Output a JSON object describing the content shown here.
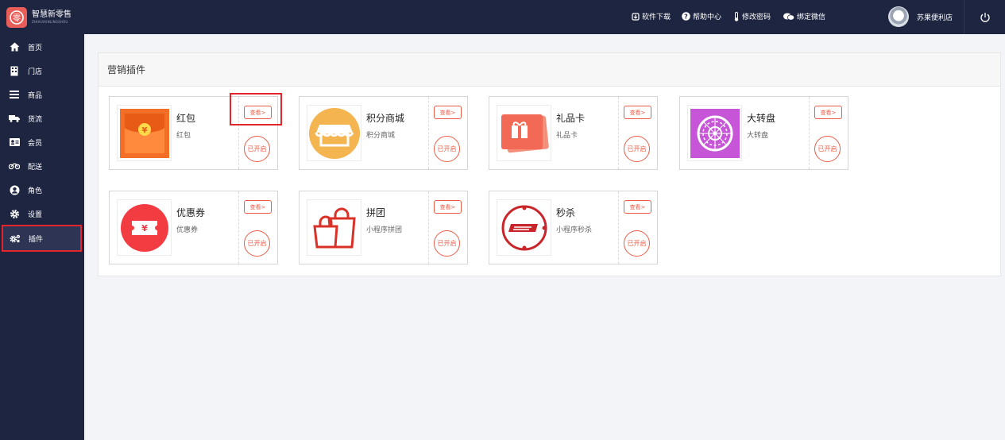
{
  "brand": {
    "name_cn": "智慧新零售",
    "name_en": "ZHIHUIXINLINGSHOU",
    "logo_char": "零"
  },
  "topnav": {
    "download": "软件下载",
    "help": "帮助中心",
    "change_password": "修改密码",
    "bind_wechat": "绑定微信"
  },
  "user": {
    "store_name": "苏果便利店"
  },
  "sidebar": {
    "items": [
      {
        "label": "首页",
        "icon": "home-icon"
      },
      {
        "label": "门店",
        "icon": "store-icon"
      },
      {
        "label": "商品",
        "icon": "list-icon"
      },
      {
        "label": "货流",
        "icon": "truck-icon"
      },
      {
        "label": "会员",
        "icon": "id-card-icon"
      },
      {
        "label": "配送",
        "icon": "motorbike-icon"
      },
      {
        "label": "角色",
        "icon": "user-circle-icon"
      },
      {
        "label": "设置",
        "icon": "gear-icon"
      },
      {
        "label": "插件",
        "icon": "gears-icon"
      }
    ]
  },
  "panel": {
    "title": "营销插件",
    "view_label": "查看>",
    "status_label": "已开启",
    "plugins": [
      {
        "name": "红包",
        "desc": "红包",
        "icon": "red-envelope-icon"
      },
      {
        "name": "积分商城",
        "desc": "积分商城",
        "icon": "store-awning-icon"
      },
      {
        "name": "礼品卡",
        "desc": "礼品卡",
        "icon": "gift-card-icon"
      },
      {
        "name": "大转盘",
        "desc": "大转盘",
        "icon": "lucky-wheel-icon"
      },
      {
        "name": "优惠券",
        "desc": "优惠券",
        "icon": "coupon-icon"
      },
      {
        "name": "拼团",
        "desc": "小程序拼团",
        "icon": "shopping-bag-icon"
      },
      {
        "name": "秒杀",
        "desc": "小程序秒杀",
        "icon": "flash-sale-icon"
      }
    ]
  },
  "colors": {
    "sidebar_bg": "#1e2541",
    "accent": "#ea5c48",
    "highlight": "#e3242b"
  }
}
